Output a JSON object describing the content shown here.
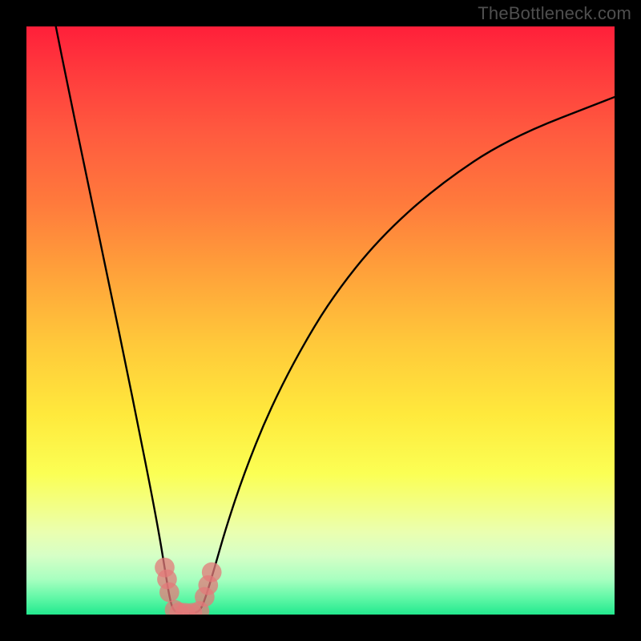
{
  "watermark": "TheBottleneck.com",
  "chart_data": {
    "type": "line",
    "title": "",
    "xlabel": "",
    "ylabel": "",
    "xlim": [
      0,
      100
    ],
    "ylim": [
      0,
      100
    ],
    "grid": false,
    "legend": false,
    "gradient_stops": [
      {
        "pos": 0,
        "color": "#ff1f3a"
      },
      {
        "pos": 8,
        "color": "#ff3b3d"
      },
      {
        "pos": 18,
        "color": "#ff5a3f"
      },
      {
        "pos": 30,
        "color": "#ff7a3c"
      },
      {
        "pos": 42,
        "color": "#ffa23a"
      },
      {
        "pos": 54,
        "color": "#ffc93a"
      },
      {
        "pos": 66,
        "color": "#ffe93c"
      },
      {
        "pos": 76,
        "color": "#fbff54"
      },
      {
        "pos": 82,
        "color": "#f2ff8a"
      },
      {
        "pos": 86,
        "color": "#eaffb0"
      },
      {
        "pos": 90,
        "color": "#d6ffc6"
      },
      {
        "pos": 94,
        "color": "#a8ffc0"
      },
      {
        "pos": 97,
        "color": "#64f8a8"
      },
      {
        "pos": 100,
        "color": "#23e98e"
      }
    ],
    "series": [
      {
        "name": "bottleneck-curve",
        "color": "#000000",
        "points": [
          {
            "x": 5.0,
            "y": 100.0
          },
          {
            "x": 7.0,
            "y": 90.0
          },
          {
            "x": 9.5,
            "y": 78.0
          },
          {
            "x": 12.0,
            "y": 66.0
          },
          {
            "x": 14.5,
            "y": 54.0
          },
          {
            "x": 17.0,
            "y": 42.0
          },
          {
            "x": 19.0,
            "y": 32.0
          },
          {
            "x": 21.0,
            "y": 22.0
          },
          {
            "x": 22.5,
            "y": 14.0
          },
          {
            "x": 23.5,
            "y": 8.0
          },
          {
            "x": 24.3,
            "y": 3.0
          },
          {
            "x": 25.0,
            "y": 0.5
          },
          {
            "x": 26.5,
            "y": 0.2
          },
          {
            "x": 28.0,
            "y": 0.2
          },
          {
            "x": 29.5,
            "y": 0.5
          },
          {
            "x": 30.5,
            "y": 3.0
          },
          {
            "x": 32.0,
            "y": 8.0
          },
          {
            "x": 34.0,
            "y": 15.0
          },
          {
            "x": 37.0,
            "y": 24.0
          },
          {
            "x": 41.0,
            "y": 34.0
          },
          {
            "x": 46.0,
            "y": 44.0
          },
          {
            "x": 52.0,
            "y": 54.0
          },
          {
            "x": 60.0,
            "y": 64.0
          },
          {
            "x": 70.0,
            "y": 73.0
          },
          {
            "x": 82.0,
            "y": 81.0
          },
          {
            "x": 100.0,
            "y": 88.0
          }
        ]
      }
    ],
    "markers": {
      "color": "#e37a7a",
      "radius": 1.0,
      "points": [
        {
          "x": 23.5,
          "y": 8.0
        },
        {
          "x": 23.9,
          "y": 6.0
        },
        {
          "x": 24.3,
          "y": 3.8
        },
        {
          "x": 25.2,
          "y": 0.8
        },
        {
          "x": 26.0,
          "y": 0.4
        },
        {
          "x": 27.0,
          "y": 0.3
        },
        {
          "x": 28.2,
          "y": 0.3
        },
        {
          "x": 29.4,
          "y": 0.6
        },
        {
          "x": 30.3,
          "y": 3.0
        },
        {
          "x": 30.9,
          "y": 5.0
        },
        {
          "x": 31.5,
          "y": 7.2
        }
      ]
    }
  }
}
